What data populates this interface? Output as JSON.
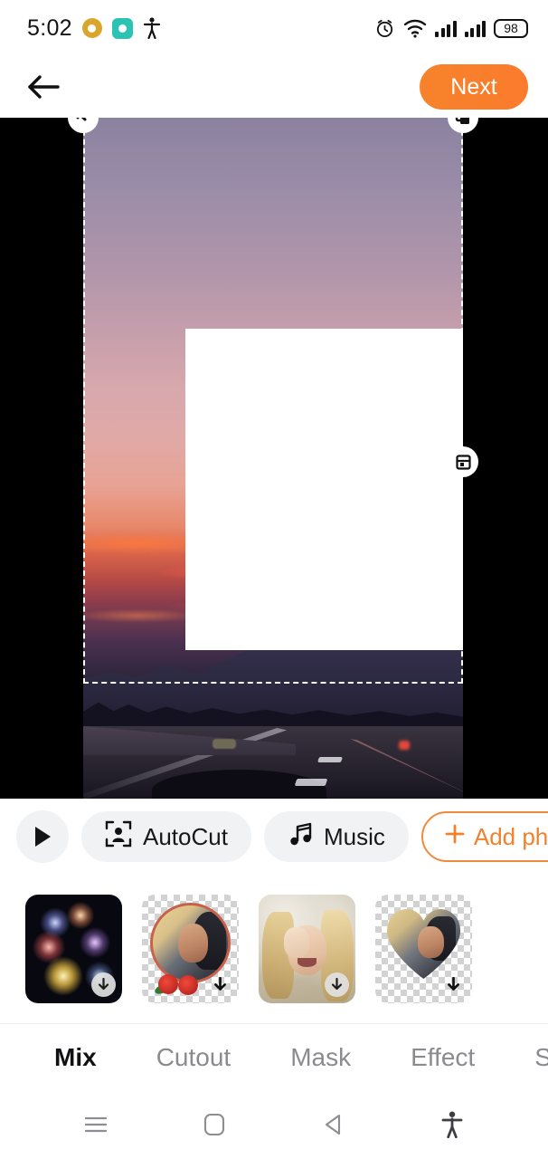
{
  "status_bar": {
    "time": "5:02",
    "battery_level": "98",
    "left_icons": [
      "download-badge-icon",
      "messenger-icon",
      "accessibility-icon"
    ],
    "right_icons": [
      "alarm-icon",
      "wifi-icon",
      "signal-icon",
      "signal-icon",
      "battery-icon"
    ]
  },
  "app_bar": {
    "back_label": "back-arrow",
    "next_label": "Next",
    "next_color": "#F8832B"
  },
  "editor": {
    "canvas_background": "#000000",
    "selection_border_color": "#FFFFFF",
    "handles": [
      "rotate-handle",
      "duplicate-handle",
      "crop-handle"
    ],
    "placed_layer_color": "#FFFFFF",
    "photo_description": "sunset-highway-mountains"
  },
  "toolbar": {
    "play_label": "play-icon",
    "items": [
      {
        "label": "AutoCut",
        "icon": "autocut-icon",
        "style": "filled"
      },
      {
        "label": "Music",
        "icon": "music-note-icon",
        "style": "filled"
      },
      {
        "label": "Add photo",
        "icon": "plus-icon",
        "style": "outline"
      }
    ],
    "accent_color": "#F0822E"
  },
  "thumbnails": [
    {
      "name": "fireworks",
      "transparent": false,
      "badge": "download-icon"
    },
    {
      "name": "portrait-rose-circle-frame",
      "transparent": true,
      "badge": "download-icon"
    },
    {
      "name": "blonde-woman-flower",
      "transparent": false,
      "badge": "download-icon"
    },
    {
      "name": "portrait-heart-cutout",
      "transparent": true,
      "badge": "download-icon"
    }
  ],
  "tabs": [
    {
      "label": "Mix",
      "active": true
    },
    {
      "label": "Cutout",
      "active": false
    },
    {
      "label": "Mask",
      "active": false
    },
    {
      "label": "Effect",
      "active": false
    },
    {
      "label": "Sticker",
      "active": false
    }
  ],
  "nav_bar": {
    "items": [
      "recents-icon",
      "home-icon",
      "back-icon",
      "accessibility-icon"
    ]
  }
}
